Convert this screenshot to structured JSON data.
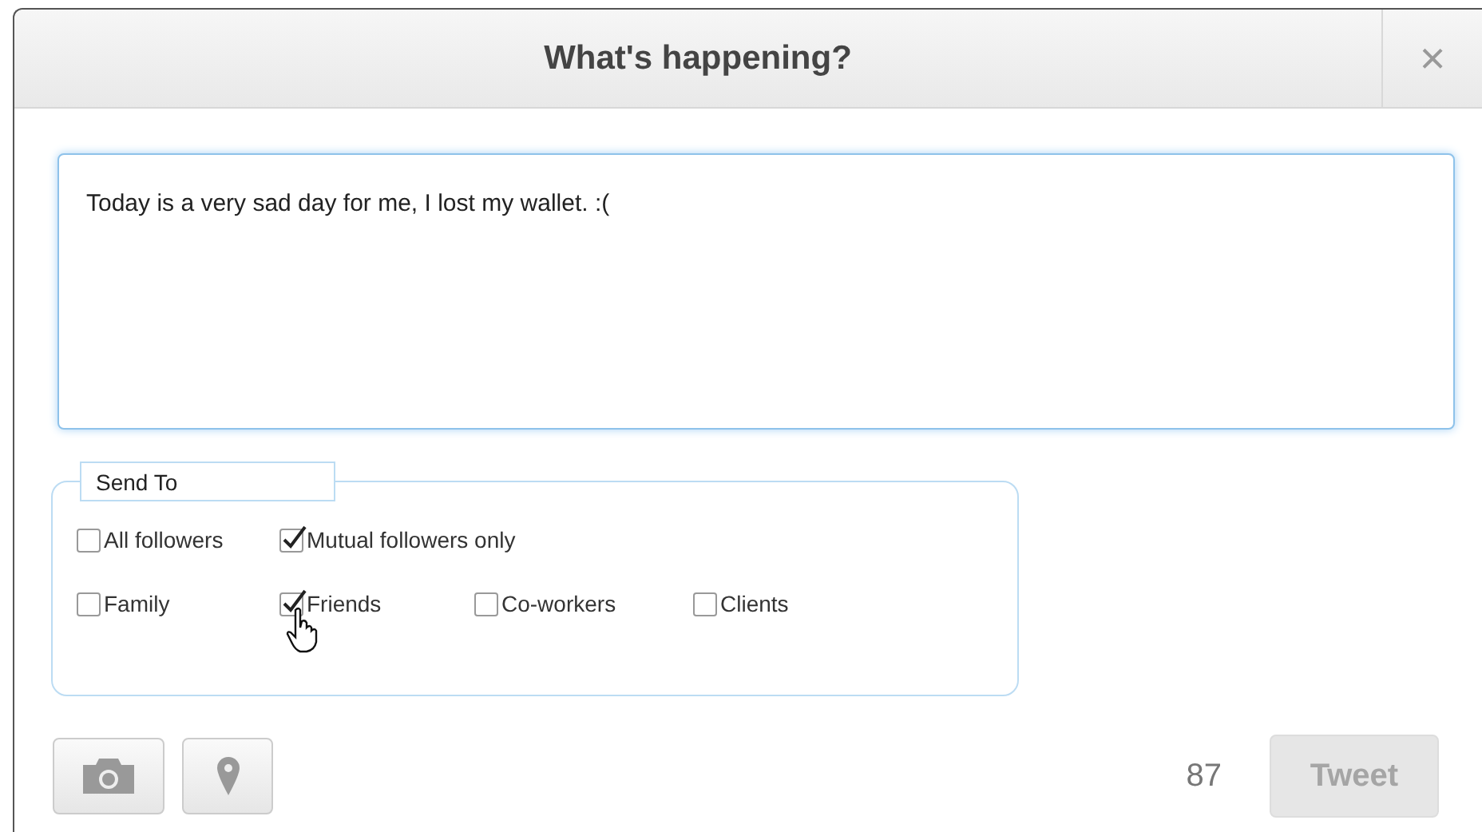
{
  "dialog": {
    "title": "What's happening?",
    "close": "×"
  },
  "composer": {
    "value": "Today is a very sad day for me, I lost my wallet. :("
  },
  "send_to": {
    "legend": "Send To",
    "rows": [
      [
        {
          "label": "All followers",
          "checked": false
        },
        {
          "label": "Mutual followers only",
          "checked": true
        }
      ],
      [
        {
          "label": "Family",
          "checked": false
        },
        {
          "label": "Friends",
          "checked": true,
          "hovered": true
        },
        {
          "label": "Co-workers",
          "checked": false
        },
        {
          "label": "Clients",
          "checked": false
        }
      ]
    ]
  },
  "footer": {
    "count": "87",
    "tweet": {
      "label": "Tweet",
      "disabled": true
    }
  }
}
